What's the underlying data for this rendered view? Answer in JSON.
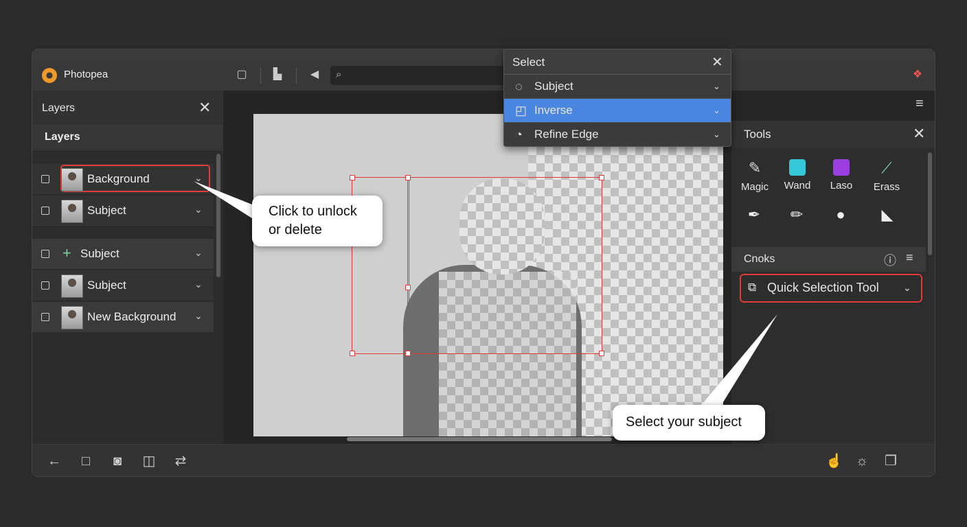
{
  "app": {
    "title": "Photopea"
  },
  "search": {
    "placeholder": ""
  },
  "layers_panel": {
    "header": "Layers",
    "subheader": "Layers",
    "rows": [
      {
        "name": "Background",
        "highlighted": true
      },
      {
        "name": "Subject"
      },
      {
        "name": "Subject",
        "icon": "plus-icon"
      },
      {
        "name": "Subject"
      },
      {
        "name": "New Background"
      }
    ]
  },
  "select_menu": {
    "title": "Select",
    "items": [
      {
        "label": "Subject",
        "icon": "spinner-icon"
      },
      {
        "label": "Inverse",
        "icon": "inverse-icon",
        "active": true
      },
      {
        "label": "Refine Edge",
        "icon": "refine-icon"
      }
    ]
  },
  "tools_panel": {
    "header": "Tools",
    "tools": [
      {
        "label": "Magic",
        "icon": "brush-icon",
        "color": "#d9d9d9"
      },
      {
        "label": "Wand",
        "icon": "cyan-cube-icon",
        "color": "#35c8d8"
      },
      {
        "label": "Laso",
        "icon": "purple-cube-icon",
        "color": "#9b3fe0"
      },
      {
        "label": "Erass",
        "icon": "eraser-icon",
        "color": "#7fd8b0"
      }
    ],
    "icons_row2": [
      "pen-icon",
      "pencil-icon",
      "blob-icon",
      "cursor-icon"
    ]
  },
  "cnoks_panel": {
    "header": "Cnoks",
    "dropdown": "Quick Selection Tool"
  },
  "callouts": {
    "left": {
      "line1": "Click to unlock",
      "line2": "or delete"
    },
    "right": "Select your subject"
  },
  "accent_color": "#4a86e0",
  "highlight_color": "#e03a3a"
}
